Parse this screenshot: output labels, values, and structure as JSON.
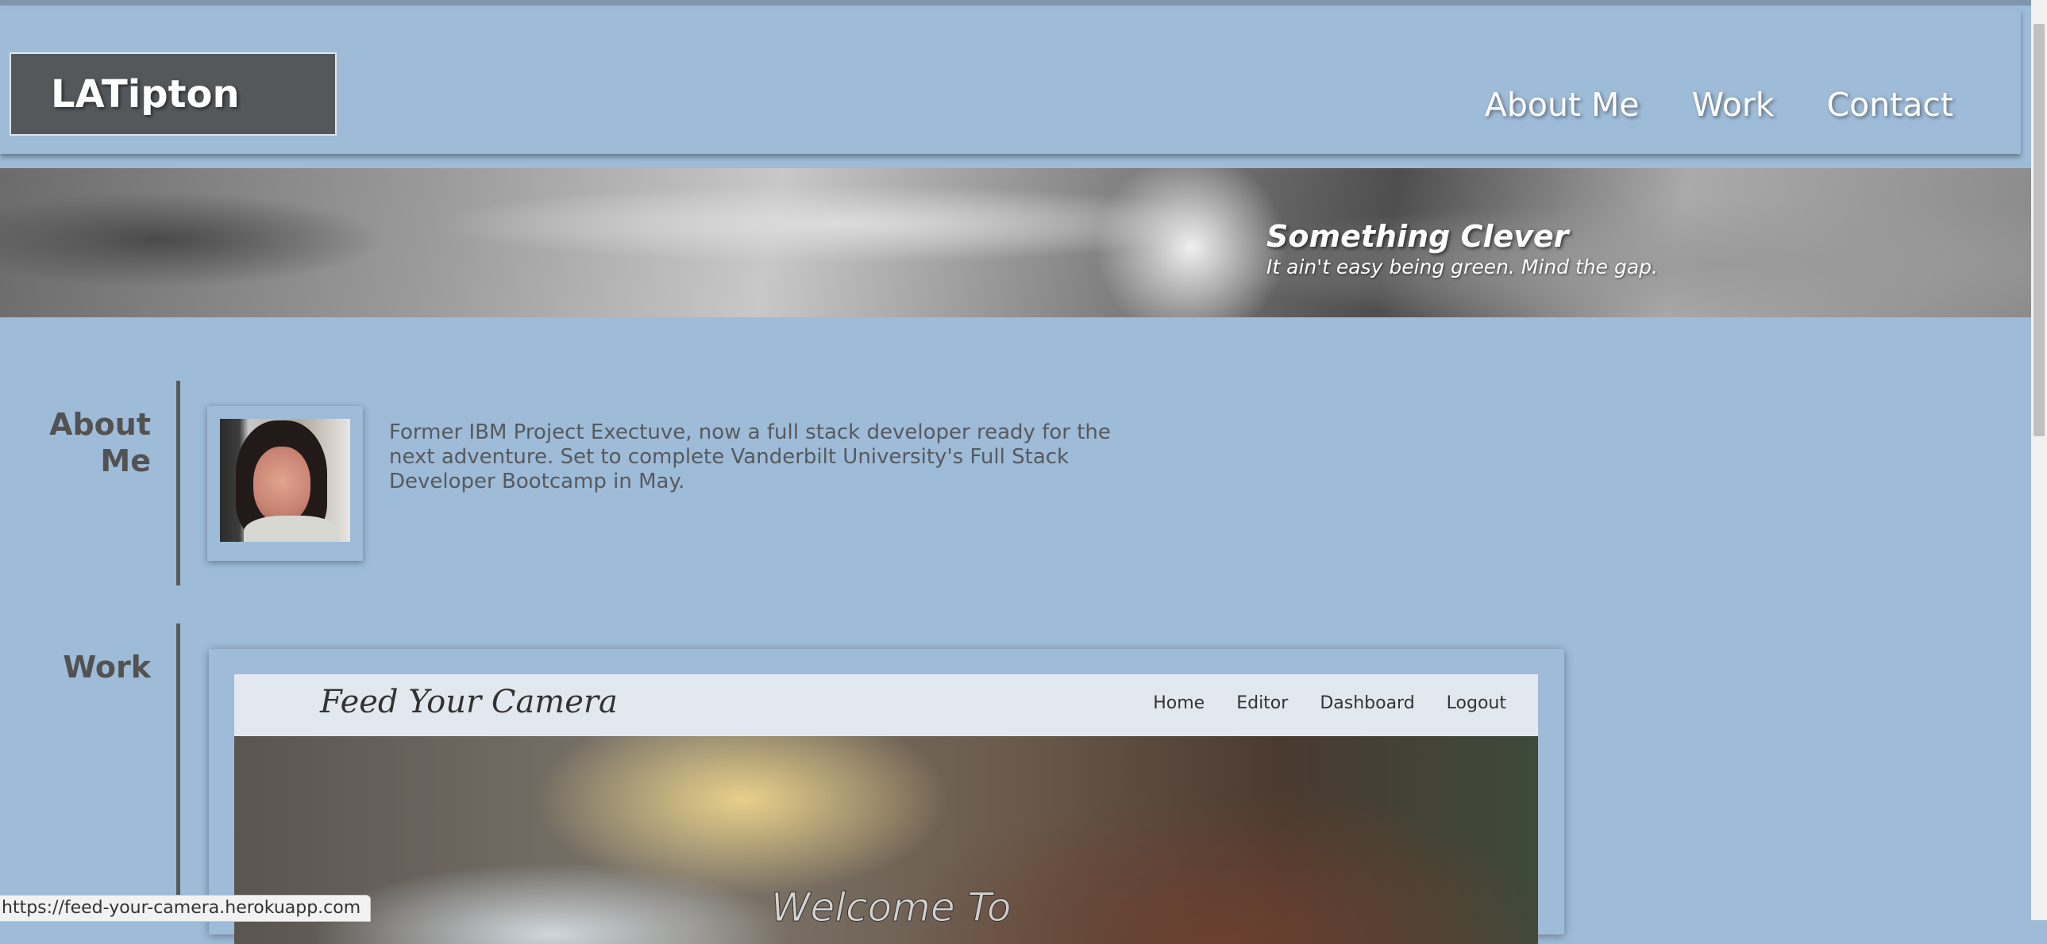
{
  "header": {
    "logo": "LATipton",
    "nav": [
      "About Me",
      "Work",
      "Contact"
    ]
  },
  "hero": {
    "title": "Something Clever",
    "subtitle": "It ain't easy being green. Mind the gap."
  },
  "about": {
    "label_line1": "About",
    "label_line2": "Me",
    "text": "Former IBM Project Exectuve, now a full stack developer ready for the next adventure. Set to complete Vanderbilt University's Full Stack Developer Bootcamp in May."
  },
  "work": {
    "label": "Work",
    "preview": {
      "brand": "Feed Your Camera",
      "links": [
        "Home",
        "Editor",
        "Dashboard",
        "Logout"
      ],
      "welcome": "Welcome To"
    }
  },
  "status_bar": {
    "url": "https://feed-your-camera.herokuapp.com"
  }
}
